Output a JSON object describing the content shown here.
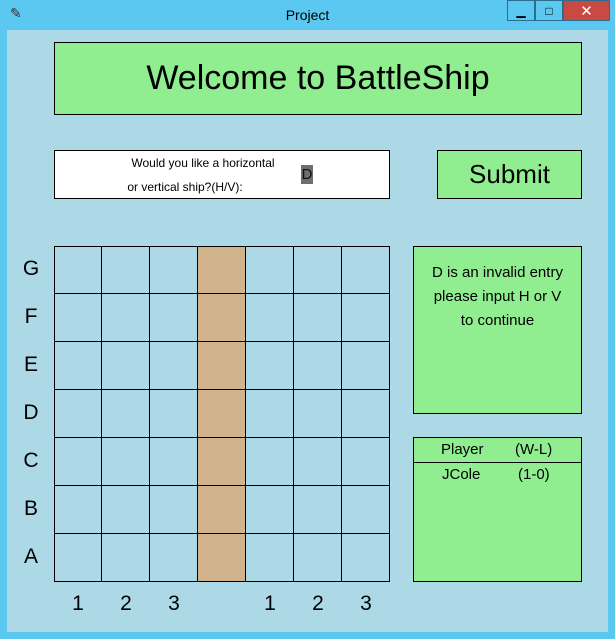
{
  "window": {
    "title": "Project",
    "icon": "feather-icon",
    "buttons": {
      "minimize": "▁",
      "maximize": "□",
      "close": "✕"
    }
  },
  "header": {
    "title": "Welcome to BattleShip"
  },
  "prompt": {
    "line1": "Would you like a horizontal",
    "line2": "or vertical ship?(H/V):",
    "value": "D"
  },
  "submit_label": "Submit",
  "board": {
    "rows": [
      "G",
      "F",
      "E",
      "D",
      "C",
      "B",
      "A"
    ],
    "columns": [
      "1",
      "2",
      "3",
      "",
      "1",
      "2",
      "3"
    ],
    "ship_column": 4,
    "colors": {
      "water": "#add8e6",
      "ship": "#d2b48c",
      "panel": "#90ee90"
    }
  },
  "message": {
    "line1": "D is an invalid entry",
    "line2": "please input H or V",
    "line3": "to continue"
  },
  "scoreboard": {
    "headers": [
      "Player",
      "(W-L)"
    ],
    "rows": [
      {
        "player": "JCole",
        "record": "(1-0)"
      }
    ]
  }
}
